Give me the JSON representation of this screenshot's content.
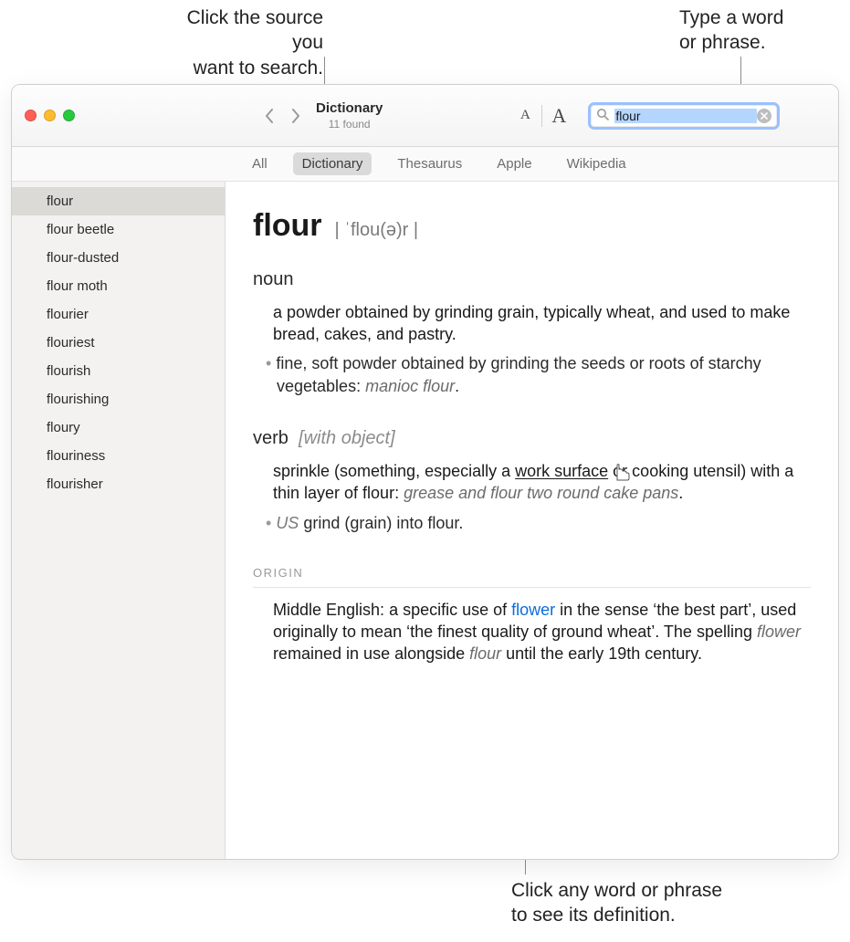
{
  "callouts": {
    "top_left_l1": "Click the source you",
    "top_left_l2": "want to search.",
    "top_right_l1": "Type a word",
    "top_right_l2": "or phrase.",
    "bottom_l1": "Click any word or phrase",
    "bottom_l2": "to see its definition."
  },
  "toolbar": {
    "title": "Dictionary",
    "subtitle": "11 found",
    "font_small": "A",
    "font_big": "A"
  },
  "search": {
    "value": "flour"
  },
  "sources": {
    "items": [
      {
        "label": "All",
        "active": false
      },
      {
        "label": "Dictionary",
        "active": true
      },
      {
        "label": "Thesaurus",
        "active": false
      },
      {
        "label": "Apple",
        "active": false
      },
      {
        "label": "Wikipedia",
        "active": false
      }
    ]
  },
  "sidebar": {
    "items": [
      {
        "label": "flour",
        "selected": true
      },
      {
        "label": "flour beetle"
      },
      {
        "label": "flour-dusted"
      },
      {
        "label": "flour moth"
      },
      {
        "label": "flourier"
      },
      {
        "label": "flouriest"
      },
      {
        "label": "flourish"
      },
      {
        "label": "flourishing"
      },
      {
        "label": "floury"
      },
      {
        "label": "flouriness"
      },
      {
        "label": "flourisher"
      }
    ]
  },
  "entry": {
    "headword": "flour",
    "pron": "| ˈflou(ə)r |",
    "noun_label": "noun",
    "noun_def": "a powder obtained by grinding grain, typically wheat, and used to make bread, cakes, and pastry.",
    "noun_sub": "fine, soft powder obtained by grinding the seeds or roots of starchy vegetables: ",
    "noun_sub_ex": "manioc flour",
    "verb_label": "verb",
    "verb_note": "[with object]",
    "verb_def_pre": "sprinkle (something, especially a ",
    "verb_def_link": "work surface",
    "verb_def_post": " or cooking utensil) with a thin layer of flour: ",
    "verb_def_ex": "grease and flour two round cake pans",
    "verb_sub_region": "US",
    "verb_sub": " grind (grain) into flour.",
    "origin_hdr": "ORIGIN",
    "origin_pre": "Middle English: a specific use of ",
    "origin_link": "flower",
    "origin_mid": " in the sense ‘the best part’, used originally to mean ‘the finest quality of ground wheat’. The spelling ",
    "origin_it1": "flower",
    "origin_mid2": " remained in use alongside ",
    "origin_it2": "flour",
    "origin_post": " until the early 19th century."
  }
}
